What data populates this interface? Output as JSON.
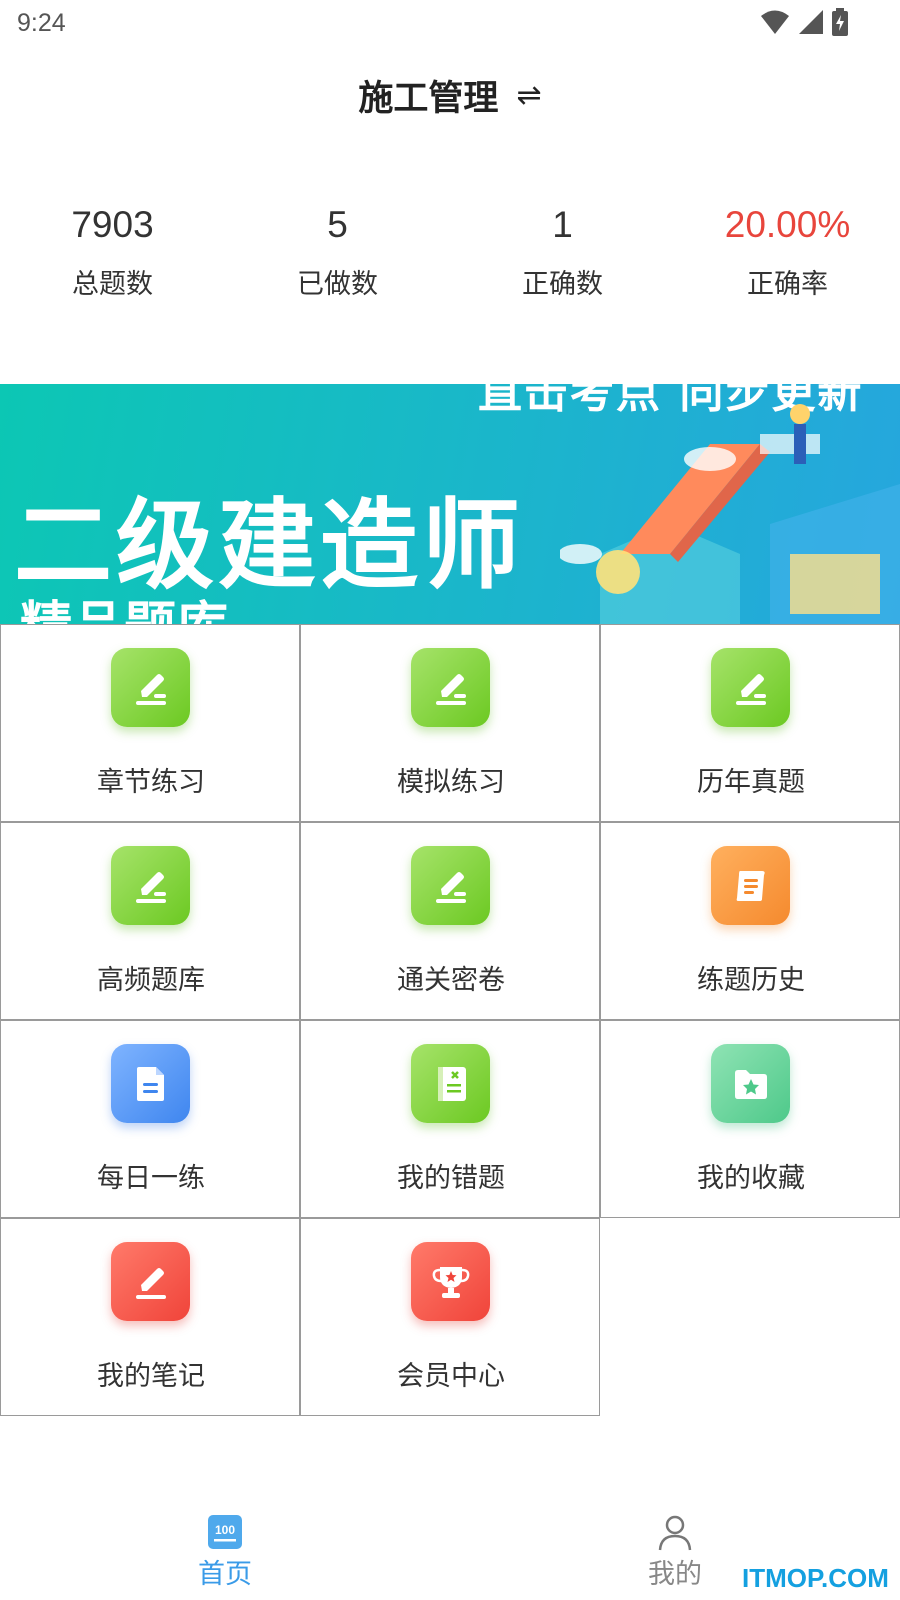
{
  "status_bar": {
    "time": "9:24"
  },
  "header": {
    "title": "施工管理",
    "switch_icon": "⇌"
  },
  "stats": [
    {
      "value": "7903",
      "label": "总题数"
    },
    {
      "value": "5",
      "label": "已做数"
    },
    {
      "value": "1",
      "label": "正确数"
    },
    {
      "value": "20.00%",
      "label": "正确率"
    }
  ],
  "banner": {
    "subtitle": "直击考点 同步更新",
    "title": "二级建造师",
    "subtitle2": "精品题库"
  },
  "grid": [
    {
      "label": "章节练习",
      "icon": "pencil-icon",
      "color": "green"
    },
    {
      "label": "模拟练习",
      "icon": "pencil-icon",
      "color": "green"
    },
    {
      "label": "历年真题",
      "icon": "pencil-icon",
      "color": "green"
    },
    {
      "label": "高频题库",
      "icon": "pencil-icon",
      "color": "green"
    },
    {
      "label": "通关密卷",
      "icon": "pencil-icon",
      "color": "green"
    },
    {
      "label": "练题历史",
      "icon": "scroll-icon",
      "color": "orange"
    },
    {
      "label": "每日一练",
      "icon": "document-icon",
      "color": "blue"
    },
    {
      "label": "我的错题",
      "icon": "notebook-icon",
      "color": "green"
    },
    {
      "label": "我的收藏",
      "icon": "star-folder-icon",
      "color": "teal"
    },
    {
      "label": "我的笔记",
      "icon": "pencil-icon",
      "color": "red"
    },
    {
      "label": "会员中心",
      "icon": "trophy-icon",
      "color": "red"
    }
  ],
  "tabbar": {
    "home": {
      "label": "首页",
      "icon": "home-100-icon",
      "active_color": "#3a9be8"
    },
    "mine": {
      "label": "我的",
      "icon": "person-icon",
      "color": "#888888"
    }
  },
  "watermark": "ITMOP.COM"
}
